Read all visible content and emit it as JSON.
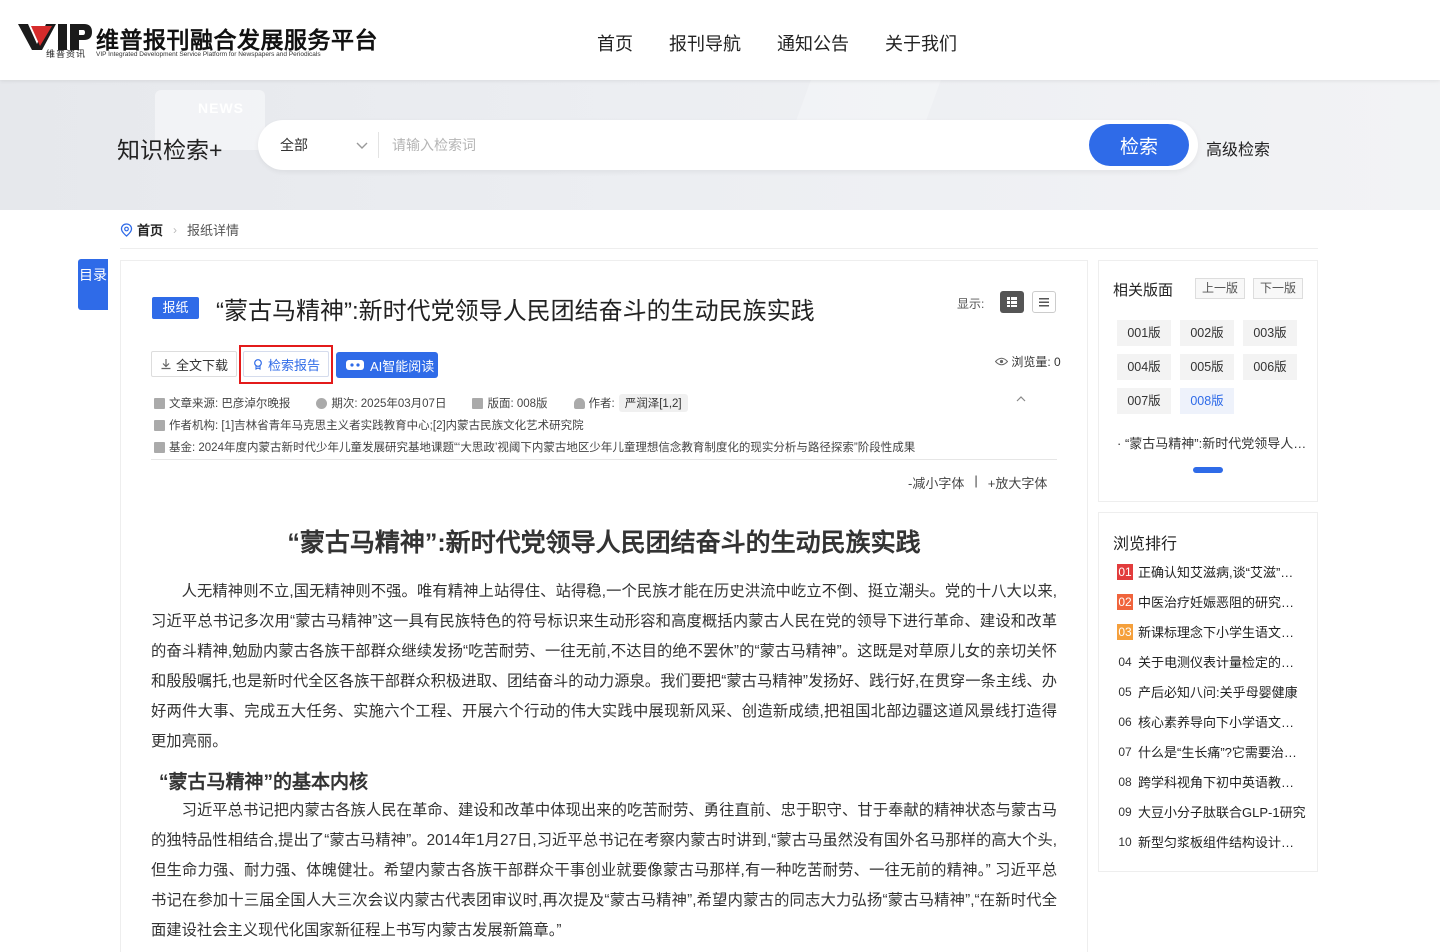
{
  "header": {
    "logo_sub": "维普资讯",
    "logo_title": "维普报刊融合发展服务平台",
    "logo_en": "VIP Integrated Development Service Platform for Newspapers and Periodicals",
    "nav": [
      "首页",
      "报刊导航",
      "通知公告",
      "关于我们"
    ]
  },
  "hero": {
    "deco_text": "NEWS",
    "title": "知识检索+",
    "category": "全部",
    "placeholder": "请输入检索词",
    "search_btn": "检索",
    "advanced": "高级检索"
  },
  "breadcrumb": {
    "home": "首页",
    "current": "报纸详情"
  },
  "toc_label": "目录",
  "article": {
    "badge": "报纸",
    "title": "“蒙古马精神”:新时代党领导人民团结奋斗的生动民族实践",
    "display_label": "显示:",
    "btn_download": "全文下载",
    "btn_report": "检索报告",
    "btn_ai": "AI智能阅读",
    "views": "浏览量: 0",
    "source": "文章来源: 巴彦淖尔晚报",
    "issue": "期次: 2025年03月07日",
    "page": "版面: 008版",
    "author_label": "作者:",
    "author": "严润泽[1,2]",
    "org": "作者机构: [1]吉林省青年马克思主义者实践教育中心;[2]内蒙古民族文化艺术研究院",
    "fund": "基金: 2024年度内蒙古新时代少年儿童发展研究基地课题“‘大思政’视阈下内蒙古地区少年儿童理想信念教育制度化的现实分析与路径探索”阶段性成果",
    "font_minus": "-减小字体",
    "font_sep": "|",
    "font_plus": "+放大字体",
    "body_title": "“蒙古马精神”:新时代党领导人民团结奋斗的生动民族实践",
    "para1": "人无精神则不立,国无精神则不强。唯有精神上站得住、站得稳,一个民族才能在历史洪流中屹立不倒、挺立潮头。党的十八大以来,习近平总书记多次用“蒙古马精神”这一具有民族特色的符号标识来生动形容和高度概括内蒙古人民在党的领导下进行革命、建设和改革的奋斗精神,勉励内蒙古各族干部群众继续发扬“吃苦耐劳、一往无前,不达目的绝不罢休”的“蒙古马精神”。这既是对草原儿女的亲切关怀和殷殷嘱托,也是新时代全区各族干部群众积极进取、团结奋斗的动力源泉。我们要把“蒙古马精神”发扬好、践行好,在贯穿一条主线、办好两件大事、完成五大任务、实施六个工程、开展六个行动的伟大实践中展现新风采、创造新成绩,把祖国北部边疆这道风景线打造得更加亮丽。",
    "sub1": "“蒙古马精神”的基本内核",
    "para2": "习近平总书记把内蒙古各族人民在革命、建设和改革中体现出来的吃苦耐劳、勇往直前、忠于职守、甘于奉献的精神状态与蒙古马的独特品性相结合,提出了“蒙古马精神”。2014年1月27日,习近平总书记在考察内蒙古时讲到,“蒙古马虽然没有国外名马那样的高大个头,但生命力强、耐力强、体魄健壮。希望内蒙古各族干部群众干事创业就要像蒙古马那样,有一种吃苦耐劳、一往无前的精神。” 习近平总书记在参加十三届全国人大三次会议内蒙古代表团审议时,再次提及“蒙古马精神”,希望内蒙古的同志大力弘扬“蒙古马精神”,“在新时代全面建设社会主义现代化国家新征程上书写内蒙古发展新篇章。”"
  },
  "related": {
    "title": "相关版面",
    "prev": "上一版",
    "next": "下一版",
    "versions": [
      "001版",
      "002版",
      "003版",
      "004版",
      "005版",
      "006版",
      "007版",
      "008版"
    ],
    "active_version": "008版",
    "article_link": "· “蒙古马精神”:新时代党领导人民团结奋斗的生动民族实践"
  },
  "ranking": {
    "title": "浏览排行",
    "items": [
      {
        "num": "01",
        "text": "正确认知艾滋病,谈“艾滋”不色变",
        "color": "#e23c3c"
      },
      {
        "num": "02",
        "text": "中医治疗妊娠恶阻的研究进展",
        "color": "#f0643c"
      },
      {
        "num": "03",
        "text": "新课标理念下小学生语文阅读能力培养",
        "color": "#f5a03c"
      },
      {
        "num": "04",
        "text": "关于电测仪表计量检定的研究",
        "color": ""
      },
      {
        "num": "05",
        "text": "产后必知八问:关乎母婴健康",
        "color": ""
      },
      {
        "num": "06",
        "text": "核心素养导向下小学语文教学策略",
        "color": ""
      },
      {
        "num": "07",
        "text": "什么是“生长痛”?它需要治疗吗",
        "color": ""
      },
      {
        "num": "08",
        "text": "跨学科视角下初中英语教学探究",
        "color": ""
      },
      {
        "num": "09",
        "text": "大豆小分子肽联合GLP-1研究",
        "color": ""
      },
      {
        "num": "10",
        "text": "新型匀浆板组件结构设计研究",
        "color": ""
      }
    ]
  },
  "colors": {
    "accent": "#2f6be8",
    "highlight_border": "#e31b1b"
  }
}
